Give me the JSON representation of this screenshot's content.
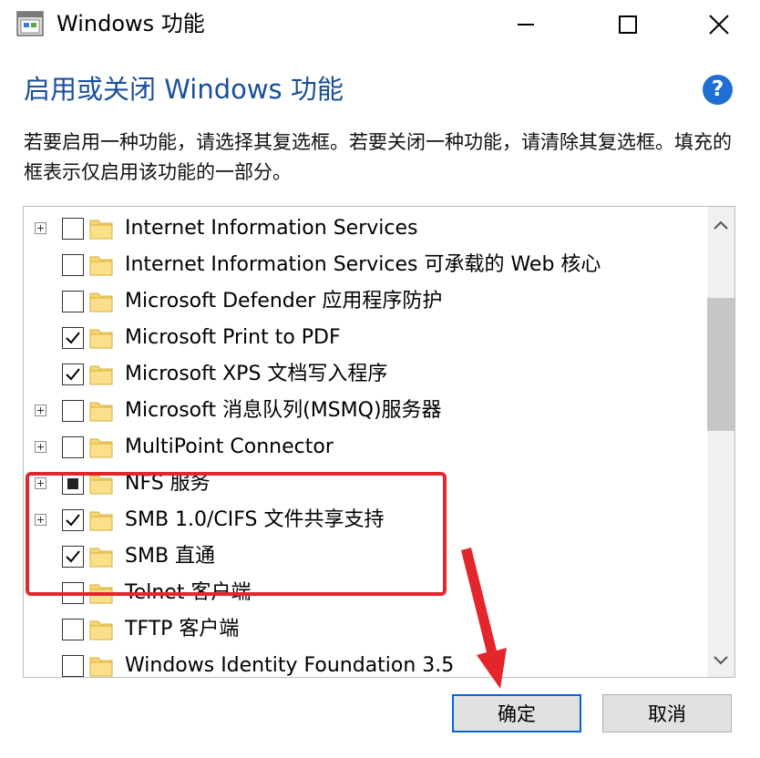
{
  "window": {
    "title": "Windows 功能",
    "icons": [
      "app-icon",
      "minimize-icon",
      "maximize-icon",
      "close-icon"
    ]
  },
  "header": {
    "heading": "启用或关闭 Windows 功能",
    "help": "?",
    "description": "若要启用一种功能，请选择其复选框。若要关闭一种功能，请清除其复选框。填充的框表示仅启用该功能的一部分。"
  },
  "features": [
    {
      "label": "Internet Information Services",
      "expandable": true,
      "state": "unchecked"
    },
    {
      "label": "Internet Information Services 可承载的 Web 核心",
      "expandable": false,
      "state": "unchecked"
    },
    {
      "label": "Microsoft Defender 应用程序防护",
      "expandable": false,
      "state": "unchecked"
    },
    {
      "label": "Microsoft Print to PDF",
      "expandable": false,
      "state": "checked"
    },
    {
      "label": "Microsoft XPS 文档写入程序",
      "expandable": false,
      "state": "checked"
    },
    {
      "label": "Microsoft 消息队列(MSMQ)服务器",
      "expandable": true,
      "state": "unchecked"
    },
    {
      "label": "MultiPoint Connector",
      "expandable": true,
      "state": "unchecked"
    },
    {
      "label": "NFS 服务",
      "expandable": true,
      "state": "partial"
    },
    {
      "label": "SMB 1.0/CIFS 文件共享支持",
      "expandable": true,
      "state": "checked"
    },
    {
      "label": "SMB 直通",
      "expandable": false,
      "state": "checked"
    },
    {
      "label": "Telnet 客户端",
      "expandable": false,
      "state": "unchecked"
    },
    {
      "label": "TFTP 客户端",
      "expandable": false,
      "state": "unchecked"
    },
    {
      "label": "Windows Identity Foundation 3.5",
      "expandable": false,
      "state": "unchecked"
    }
  ],
  "buttons": {
    "ok": "确定",
    "cancel": "取消"
  },
  "colors": {
    "heading": "#1a4f9c",
    "help_icon": "#1f6ed4",
    "annotation": "#e3262c",
    "folder": "#f7d774",
    "default_button_border": "#0a64d6"
  }
}
